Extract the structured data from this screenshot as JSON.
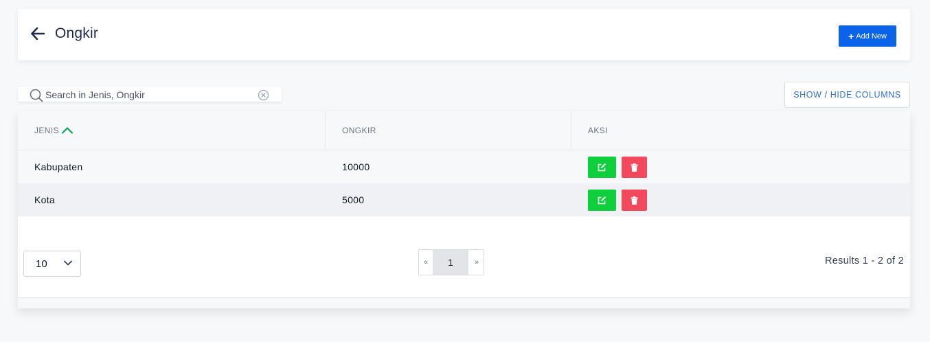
{
  "header": {
    "title": "Ongkir",
    "add_label": "Add New"
  },
  "search": {
    "placeholder": "Search in Jenis, Ongkir"
  },
  "columns_button": "SHOW / HIDE COLUMNS",
  "table": {
    "headers": [
      "JENIS",
      "ONGKIR",
      "AKSI"
    ],
    "rows": [
      {
        "jenis": "Kabupaten",
        "ongkir": "10000"
      },
      {
        "jenis": "Kota",
        "ongkir": "5000"
      }
    ]
  },
  "pagination": {
    "per_page": "10",
    "prev": "«",
    "current": "1",
    "next": "»",
    "results": "Results 1 - 2 of 2"
  },
  "colors": {
    "primary": "#0a63e8",
    "edit": "#0fcf3c",
    "delete": "#f24a5c",
    "sort_indicator": "#10a05a"
  }
}
